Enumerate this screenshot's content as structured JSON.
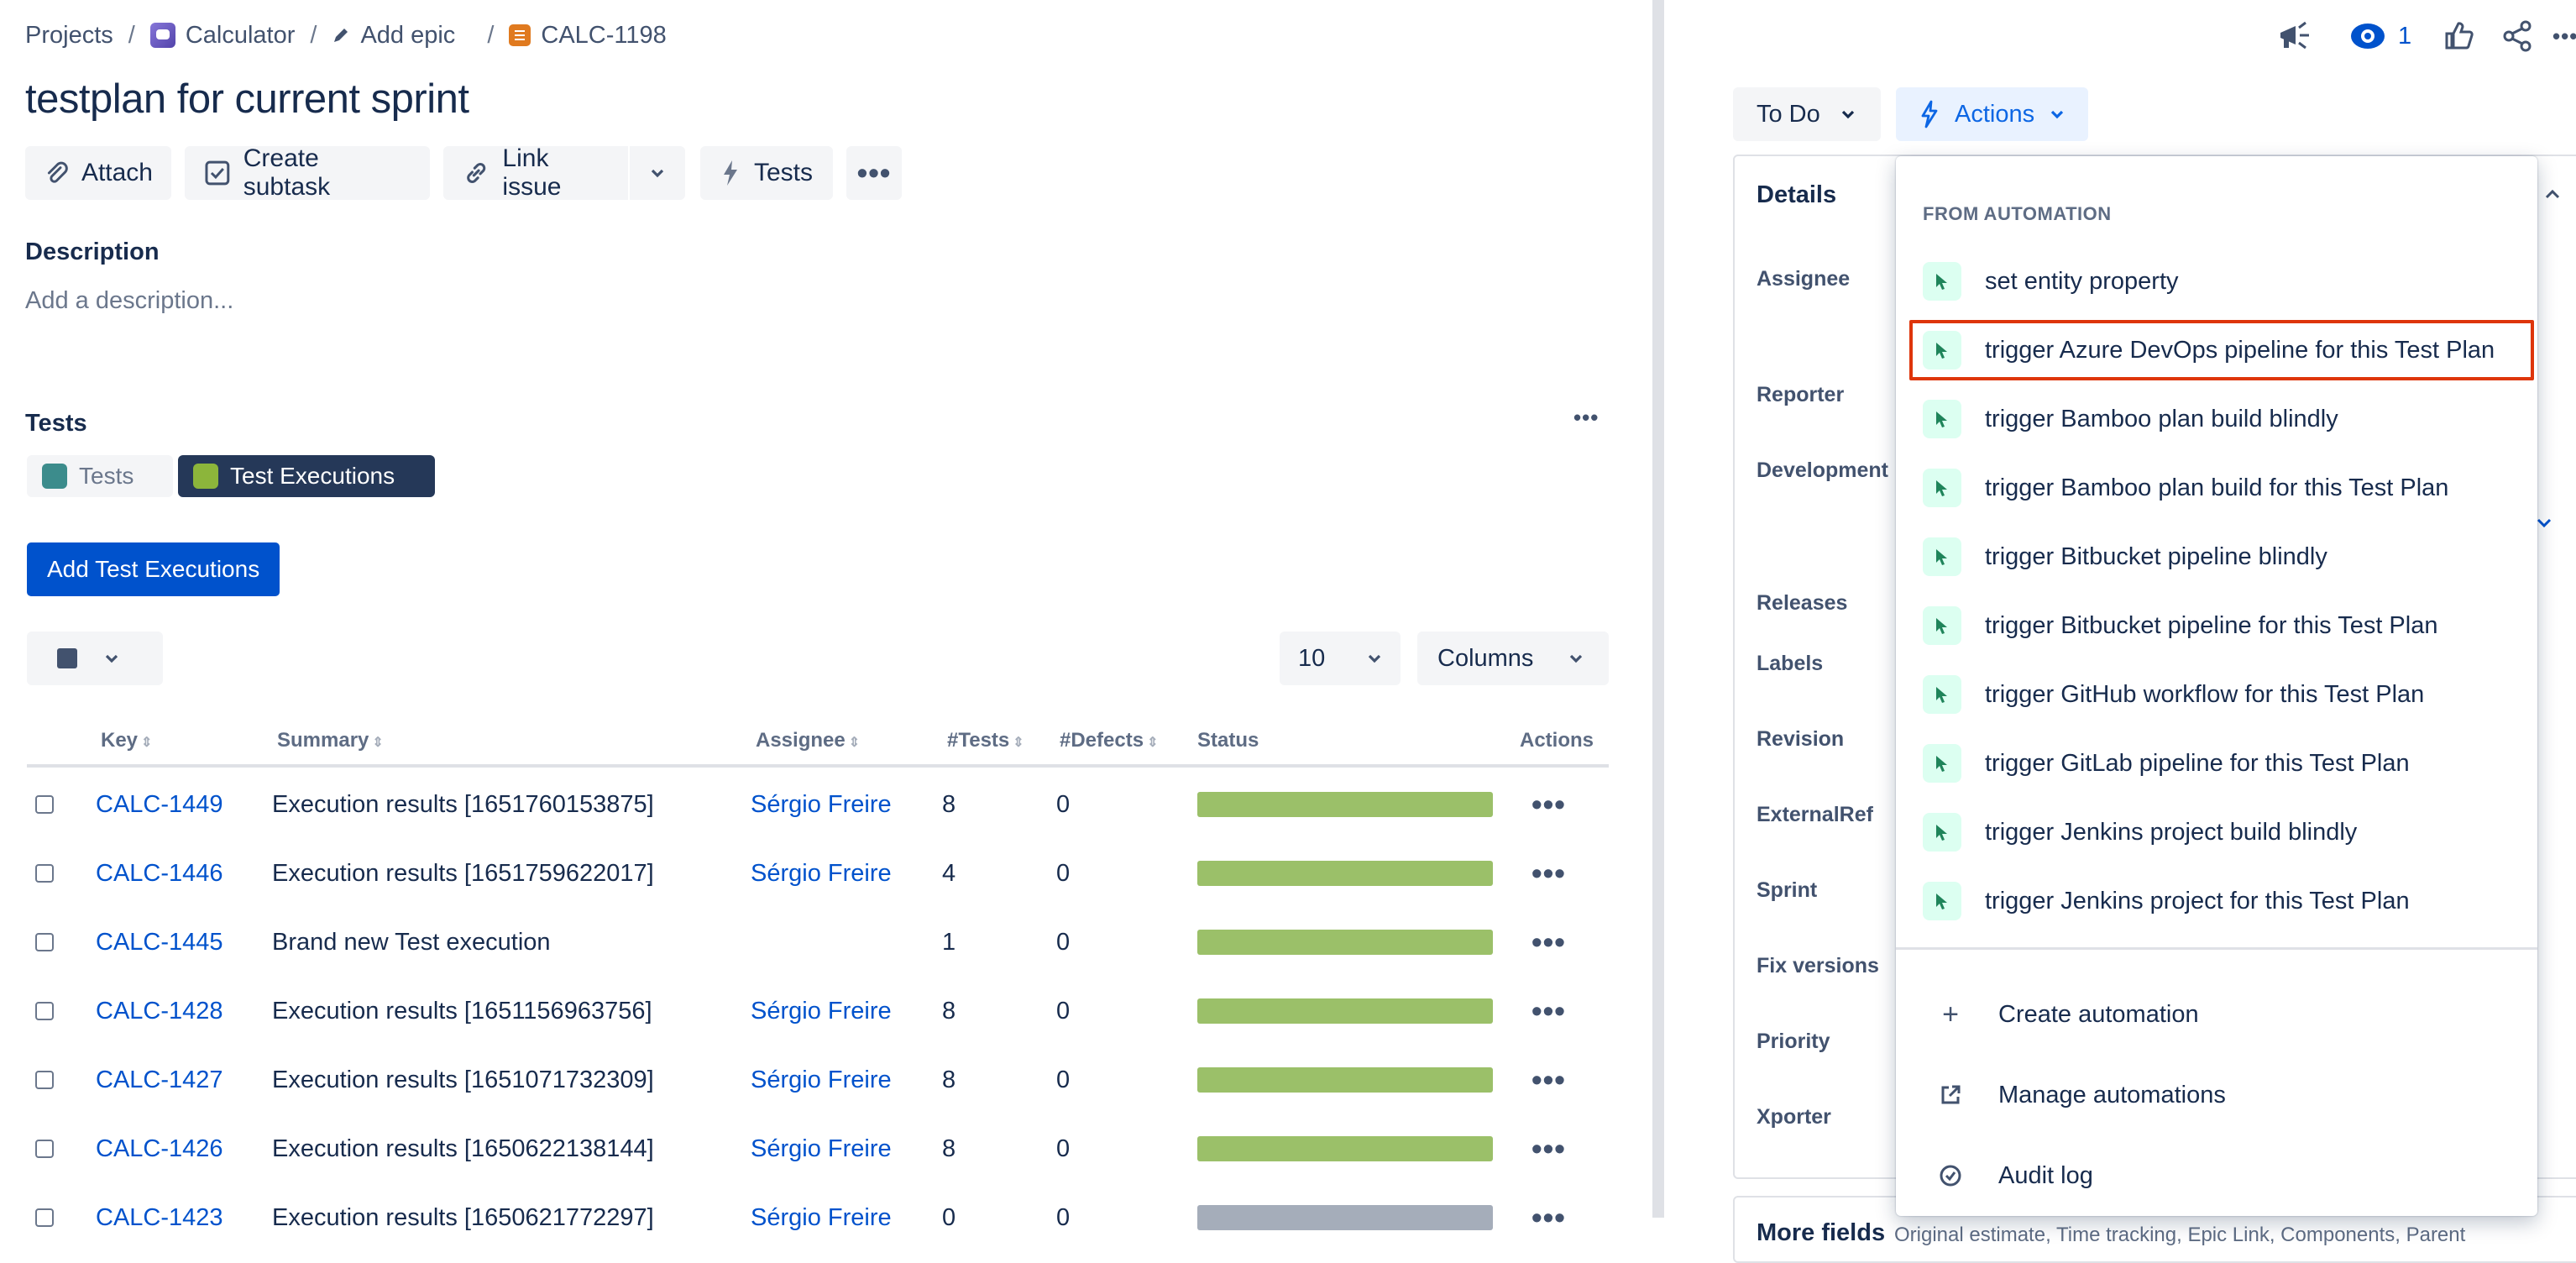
{
  "breadcrumbs": {
    "projects": "Projects",
    "project": "Calculator",
    "epic": "Add epic",
    "issue_key": "CALC-1198",
    "separator": "/"
  },
  "issue": {
    "title": "testplan for current sprint"
  },
  "toolbar": {
    "attach": "Attach",
    "create_subtask": "Create subtask",
    "link_issue": "Link issue",
    "tests": "Tests"
  },
  "description": {
    "label": "Description",
    "placeholder": "Add a description..."
  },
  "tests_section": {
    "label": "Tests",
    "tabs": [
      {
        "label": "Tests",
        "active": false
      },
      {
        "label": "Test Executions",
        "active": true
      }
    ],
    "add_button": "Add Test Executions",
    "page_size": "10",
    "columns_button": "Columns"
  },
  "table": {
    "headers": {
      "key": "Key",
      "summary": "Summary",
      "assignee": "Assignee",
      "tests": "#Tests",
      "defects": "#Defects",
      "status": "Status",
      "actions": "Actions"
    },
    "rows": [
      {
        "key": "CALC-1449",
        "summary": "Execution results [1651760153875]",
        "assignee": "Sérgio Freire",
        "tests": "8",
        "defects": "0",
        "status_color": "#9BC069"
      },
      {
        "key": "CALC-1446",
        "summary": "Execution results [1651759622017]",
        "assignee": "Sérgio Freire",
        "tests": "4",
        "defects": "0",
        "status_color": "#9BC069"
      },
      {
        "key": "CALC-1445",
        "summary": "Brand new Test execution",
        "assignee": "",
        "tests": "1",
        "defects": "0",
        "status_color": "#9BC069"
      },
      {
        "key": "CALC-1428",
        "summary": "Execution results [1651156963756]",
        "assignee": "Sérgio Freire",
        "tests": "8",
        "defects": "0",
        "status_color": "#9BC069"
      },
      {
        "key": "CALC-1427",
        "summary": "Execution results [1651071732309]",
        "assignee": "Sérgio Freire",
        "tests": "8",
        "defects": "0",
        "status_color": "#9BC069"
      },
      {
        "key": "CALC-1426",
        "summary": "Execution results [1650622138144]",
        "assignee": "Sérgio Freire",
        "tests": "8",
        "defects": "0",
        "status_color": "#9BC069"
      },
      {
        "key": "CALC-1423",
        "summary": "Execution results [1650621772297]",
        "assignee": "Sérgio Freire",
        "tests": "0",
        "defects": "0",
        "status_color": "#A5ADBA"
      }
    ]
  },
  "header_right": {
    "watchers_count": "1"
  },
  "status": {
    "label": "To Do"
  },
  "actions": {
    "label": "Actions",
    "section_header": "FROM AUTOMATION",
    "items": [
      "set entity property",
      "trigger Azure DevOps pipeline for this Test Plan",
      "trigger Bamboo plan build blindly",
      "trigger Bamboo plan build for this Test Plan",
      "trigger Bitbucket pipeline blindly",
      "trigger Bitbucket pipeline for this Test Plan",
      "trigger GitHub workflow for this Test Plan",
      "trigger GitLab pipeline for this Test Plan",
      "trigger Jenkins project build blindly",
      "trigger Jenkins project for this Test Plan"
    ],
    "highlighted_index": 1,
    "footer": {
      "create": "Create automation",
      "manage": "Manage automations",
      "audit": "Audit log"
    }
  },
  "details": {
    "title": "Details",
    "fields": [
      "Assignee",
      "Reporter",
      "Development",
      "Releases",
      "Labels",
      "Revision",
      "ExternalRef",
      "Sprint",
      "Fix versions",
      "Priority",
      "Xporter"
    ]
  },
  "more_fields": {
    "label": "More fields",
    "hint": "Original estimate, Time tracking, Epic Link, Components, Parent"
  },
  "colors": {
    "accent": "#0052CC",
    "highlight": "#DE350B",
    "status_done": "#9BC069",
    "status_none": "#A5ADBA"
  }
}
